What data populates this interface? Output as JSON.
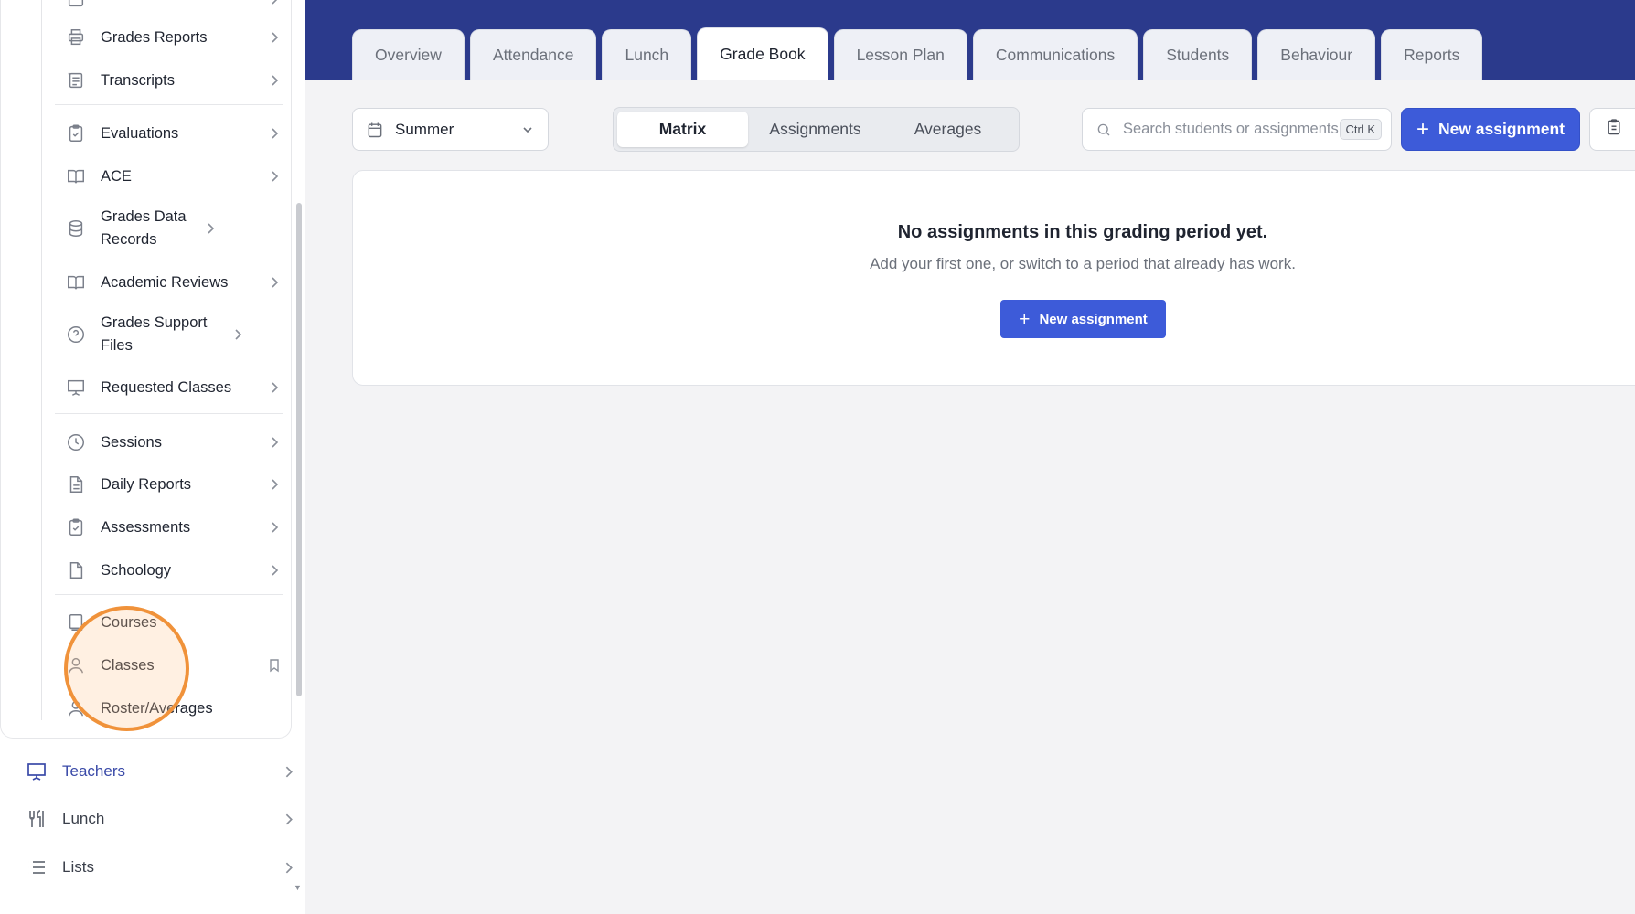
{
  "sidebar": {
    "items": [
      {
        "label": "Grades Reports",
        "icon": "printer-icon"
      },
      {
        "label": "Transcripts",
        "icon": "transcript-icon"
      },
      {
        "label": "Evaluations",
        "icon": "clipboard-check-icon"
      },
      {
        "label": "ACE",
        "icon": "book-open-icon"
      },
      {
        "label": "Grades Data Records",
        "icon": "database-icon"
      },
      {
        "label": "Academic Reviews",
        "icon": "book-open-icon"
      },
      {
        "label": "Grades Support Files",
        "icon": "help-circle-icon"
      },
      {
        "label": "Requested Classes",
        "icon": "presentation-icon"
      },
      {
        "label": "Sessions",
        "icon": "clock-icon"
      },
      {
        "label": "Daily Reports",
        "icon": "file-text-icon"
      },
      {
        "label": "Assessments",
        "icon": "clipboard-check-icon"
      },
      {
        "label": "Schoology",
        "icon": "file-icon"
      },
      {
        "label": "Courses",
        "icon": "book-icon"
      },
      {
        "label": "Classes",
        "icon": "user-icon"
      },
      {
        "label": "Roster/Averages",
        "icon": "users-icon"
      }
    ],
    "nav": [
      {
        "label": "Teachers",
        "icon": "presentation-icon"
      },
      {
        "label": "Lunch",
        "icon": "utensils-icon"
      },
      {
        "label": "Lists",
        "icon": "list-icon"
      }
    ]
  },
  "tabs": [
    "Overview",
    "Attendance",
    "Lunch",
    "Grade Book",
    "Lesson Plan",
    "Communications",
    "Students",
    "Behaviour",
    "Reports"
  ],
  "active_tab": "Grade Book",
  "toolbar": {
    "period": "Summer",
    "views": [
      "Matrix",
      "Assignments",
      "Averages"
    ],
    "active_view": "Matrix",
    "search_placeholder": "Search students or assignments",
    "shortcut": "Ctrl K",
    "new_assignment_label": "New assignment"
  },
  "empty_state": {
    "title": "No assignments in this grading period yet.",
    "subtitle": "Add your first one, or switch to a period that already has work.",
    "button_label": "New assignment"
  },
  "colors": {
    "header": "#2b3a8c",
    "primary": "#3d5bd9",
    "highlight": "#f0923a"
  }
}
